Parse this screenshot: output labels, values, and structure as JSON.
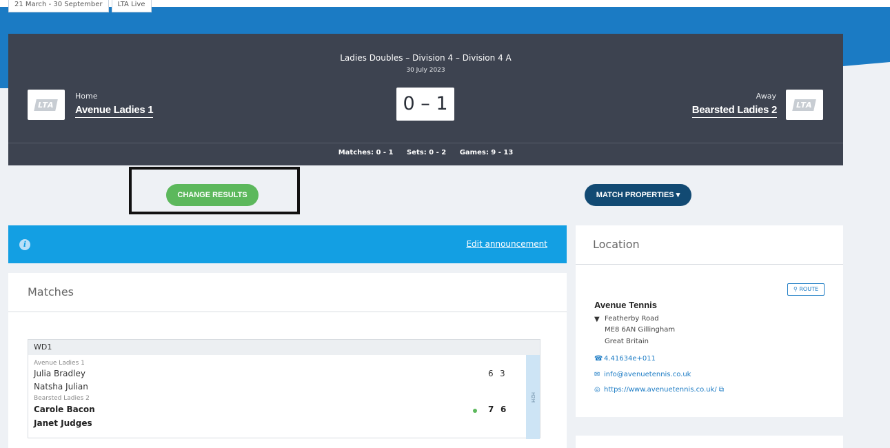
{
  "top_pills": [
    "21 March - 30 September",
    "LTA Live"
  ],
  "header": {
    "competition": "Ladies Doubles – Division 4 – Division 4 A",
    "date": "30 July 2023",
    "score": "0 – 1",
    "home_label": "Home",
    "home_team": "Avenue Ladies 1",
    "away_label": "Away",
    "away_team": "Bearsted Ladies 2",
    "logo_text": "LTA",
    "summary": {
      "matches": "Matches: 0 - 1",
      "sets": "Sets: 0 - 2",
      "games": "Games: 9 - 13"
    }
  },
  "actions": {
    "change_results": "CHANGE RESULTS",
    "match_properties": "MATCH PROPERTIES ▾"
  },
  "announcement": {
    "info_icon": "i",
    "edit_link": "Edit announcement"
  },
  "matches": {
    "title": "Matches",
    "items": [
      {
        "code": "WD1",
        "h2h": "H2H",
        "home_team": "Avenue Ladies 1",
        "home_players": [
          "Julia Bradley",
          "Natsha Julian"
        ],
        "home_scores": [
          "6",
          "3"
        ],
        "away_team": "Bearsted Ladies 2",
        "away_players": [
          "Carole Bacon",
          "Janet Judges"
        ],
        "away_scores": [
          "7",
          "6"
        ]
      }
    ]
  },
  "location": {
    "title": "Location",
    "route": "⚲ ROUTE",
    "venue": "Avenue Tennis",
    "address": [
      "Featherby Road",
      "ME8 6AN Gillingham",
      "Great Britain"
    ],
    "phone": "4.41634e+011",
    "email": "info@avenuetennis.co.uk",
    "website": "https://www.avenuetennis.co.uk/ ⧉"
  },
  "colors": {
    "brand_blue": "#1b7bc4",
    "header_dark": "#3d4350",
    "success_green": "#5cb85c",
    "navy": "#124a73",
    "info_blue": "#139fe3"
  }
}
